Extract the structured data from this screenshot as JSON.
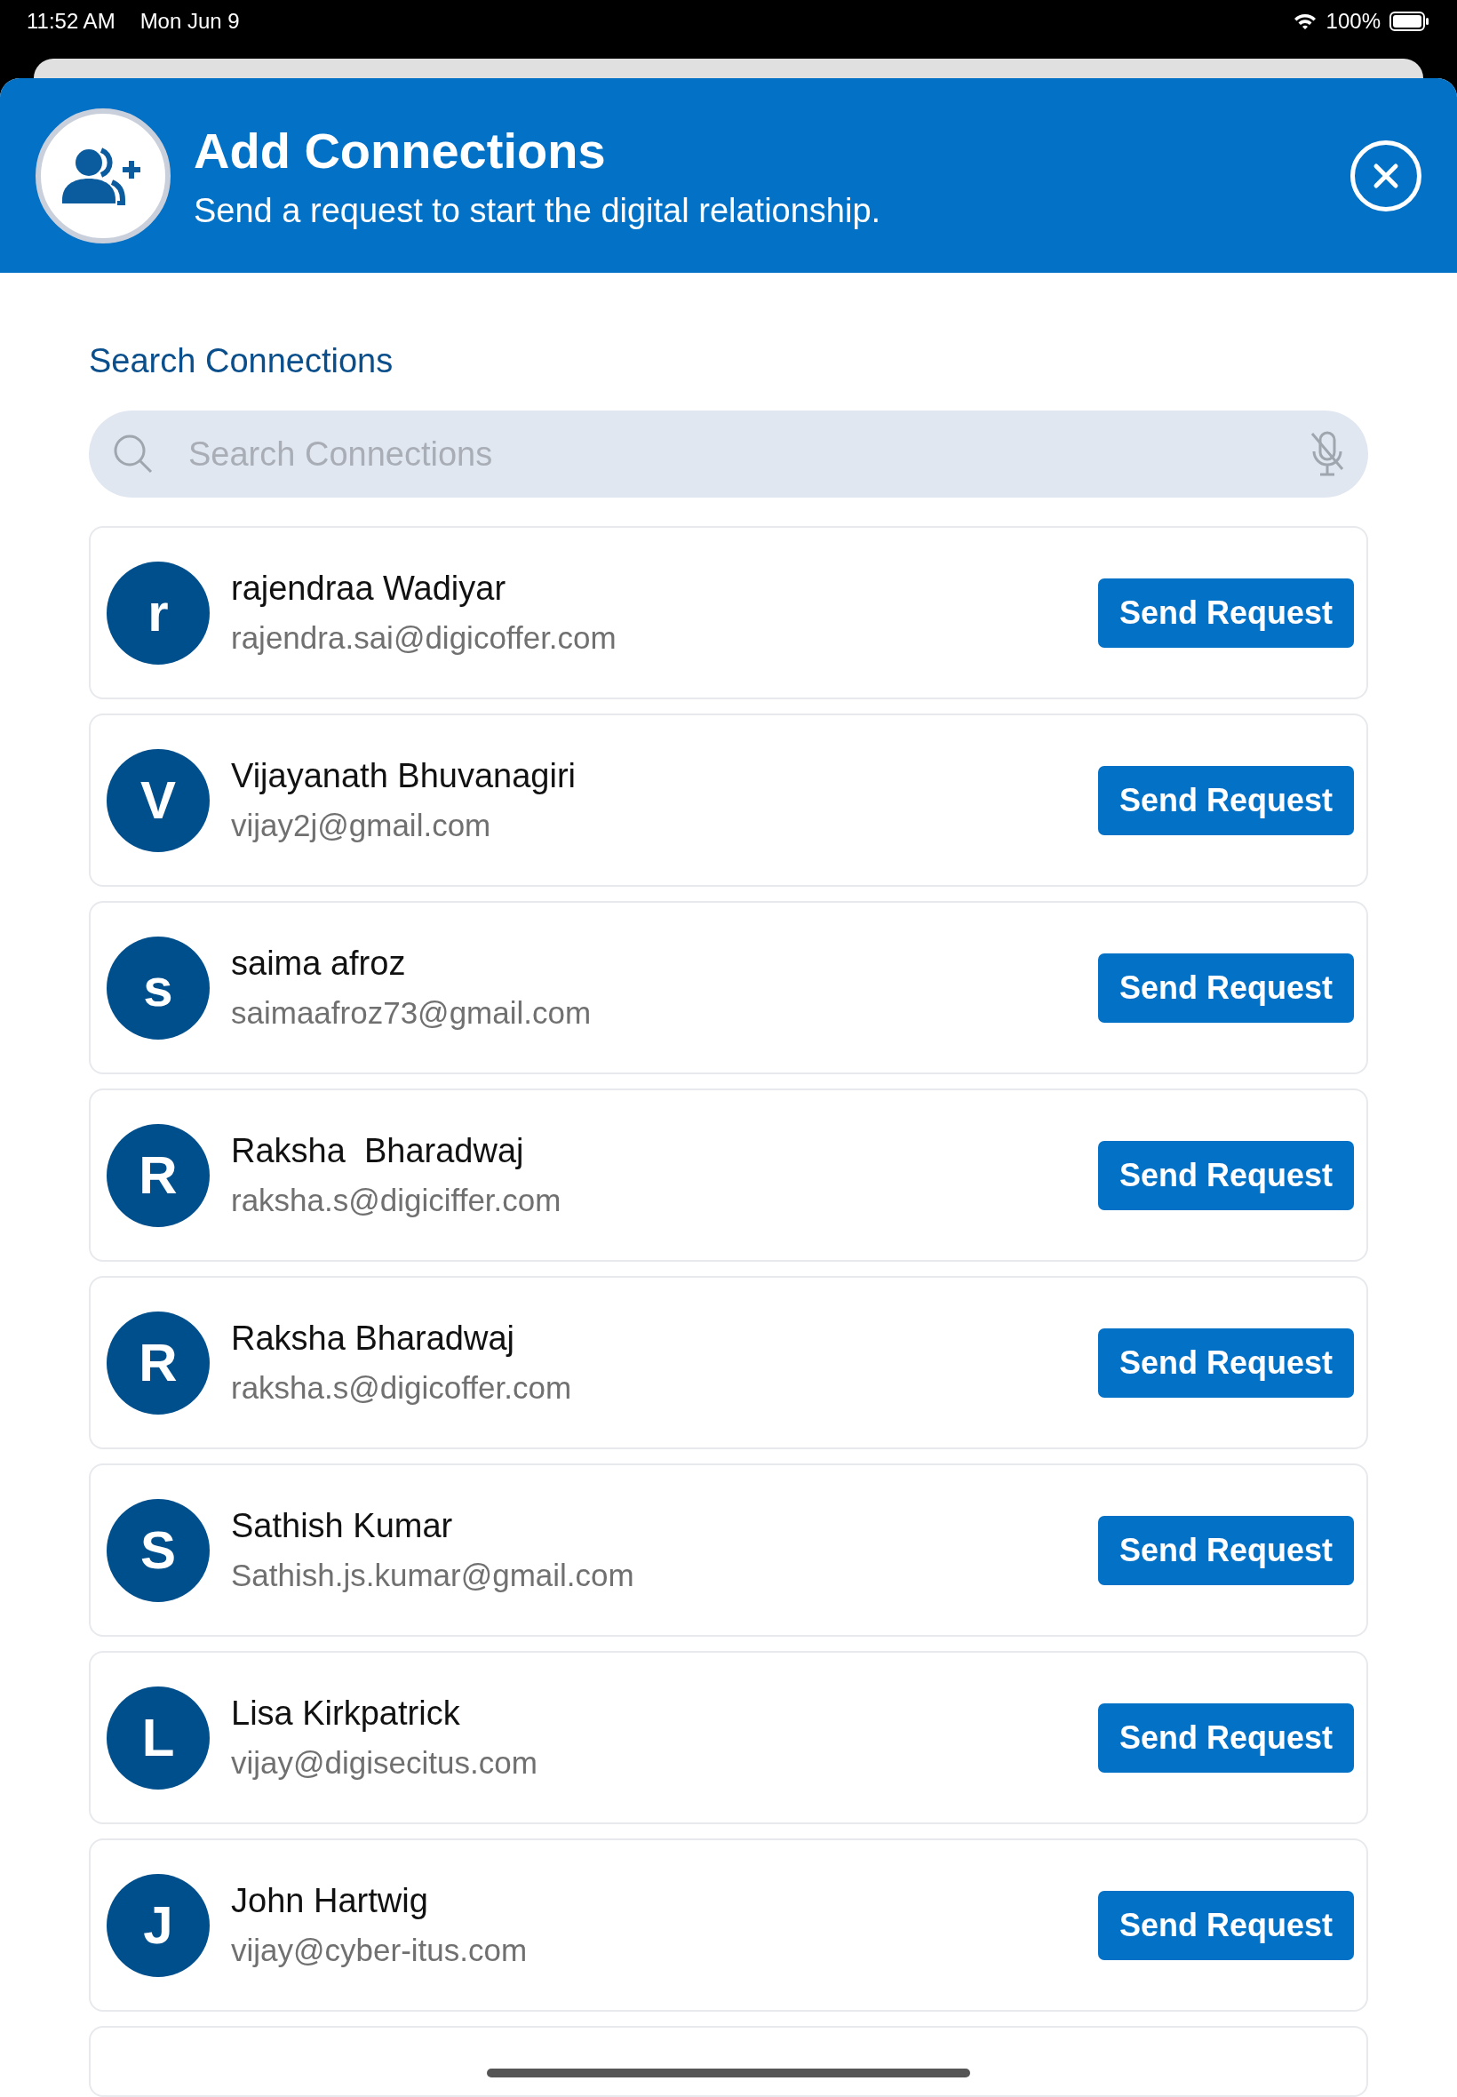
{
  "status_bar": {
    "time": "11:52 AM",
    "date": "Mon Jun 9",
    "battery": "100%"
  },
  "header": {
    "title": "Add Connections",
    "subtitle": "Send a request to start the digital relationship."
  },
  "search": {
    "label": "Search Connections",
    "placeholder": "Search Connections"
  },
  "connections": [
    {
      "initial": "r",
      "name": "rajendraa Wadiyar",
      "email": "rajendra.sai@digicoffer.com",
      "action": "Send Request"
    },
    {
      "initial": "V",
      "name": "Vijayanath Bhuvanagiri",
      "email": "vijay2j@gmail.com",
      "action": "Send Request"
    },
    {
      "initial": "s",
      "name": "saima afroz",
      "email": "saimaafroz73@gmail.com",
      "action": "Send Request"
    },
    {
      "initial": "R",
      "name": "Raksha  Bharadwaj",
      "email": "raksha.s@digiciffer.com",
      "action": "Send Request"
    },
    {
      "initial": "R",
      "name": "Raksha Bharadwaj",
      "email": "raksha.s@digicoffer.com",
      "action": "Send Request"
    },
    {
      "initial": "S",
      "name": "Sathish Kumar",
      "email": "Sathish.js.kumar@gmail.com",
      "action": "Send Request"
    },
    {
      "initial": "L",
      "name": "Lisa Kirkpatrick",
      "email": "vijay@digisecitus.com",
      "action": "Send Request"
    },
    {
      "initial": "J",
      "name": "John Hartwig",
      "email": "vijay@cyber-itus.com",
      "action": "Send Request"
    }
  ]
}
